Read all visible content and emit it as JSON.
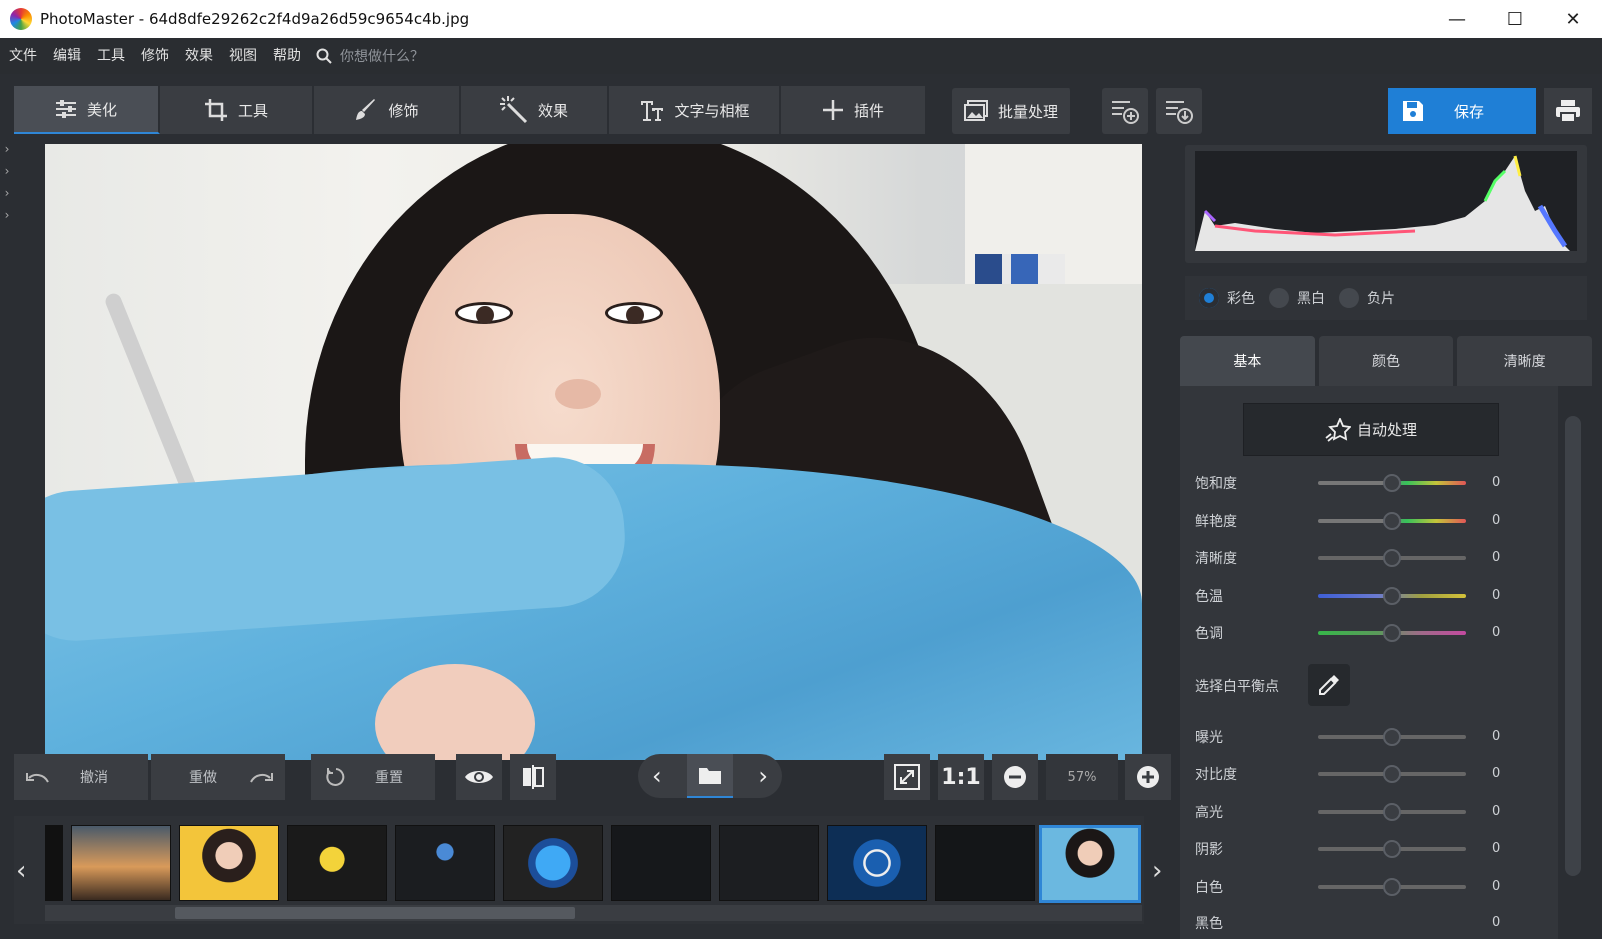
{
  "window": {
    "title": "PhotoMaster - 64d8dfe29262c2f4d9a26d59c9654c4b.jpg"
  },
  "menu": {
    "items": [
      "文件",
      "编辑",
      "工具",
      "修饰",
      "效果",
      "视图",
      "帮助"
    ],
    "search_placeholder": "你想做什么？"
  },
  "toolbar": {
    "tabs": [
      "美化",
      "工具",
      "修饰",
      "效果",
      "文字与相框",
      "插件"
    ],
    "batch": "批量处理",
    "save": "保存"
  },
  "bottom": {
    "undo": "撤消",
    "redo": "重做",
    "reset": "重置",
    "ratio": "1:1",
    "zoom": "57%"
  },
  "panel": {
    "modes": [
      "彩色",
      "黑白",
      "负片"
    ],
    "selected_mode": "彩色",
    "tabs": [
      "基本",
      "颜色",
      "清晰度"
    ],
    "auto": "自动处理",
    "wb_label": "选择白平衡点",
    "sliders": [
      {
        "label": "饱和度",
        "value": "0"
      },
      {
        "label": "鲜艳度",
        "value": "0"
      },
      {
        "label": "清晰度",
        "value": "0"
      },
      {
        "label": "色温",
        "value": "0"
      },
      {
        "label": "色调",
        "value": "0"
      },
      {
        "label": "曝光",
        "value": "0"
      },
      {
        "label": "对比度",
        "value": "0"
      },
      {
        "label": "高光",
        "value": "0"
      },
      {
        "label": "阴影",
        "value": "0"
      },
      {
        "label": "白色",
        "value": "0"
      },
      {
        "label": "黑色",
        "value": "0"
      }
    ]
  },
  "colors": {
    "accent": "#1f7fd6",
    "background": "#2b2e33",
    "button": "#3a3d42"
  }
}
